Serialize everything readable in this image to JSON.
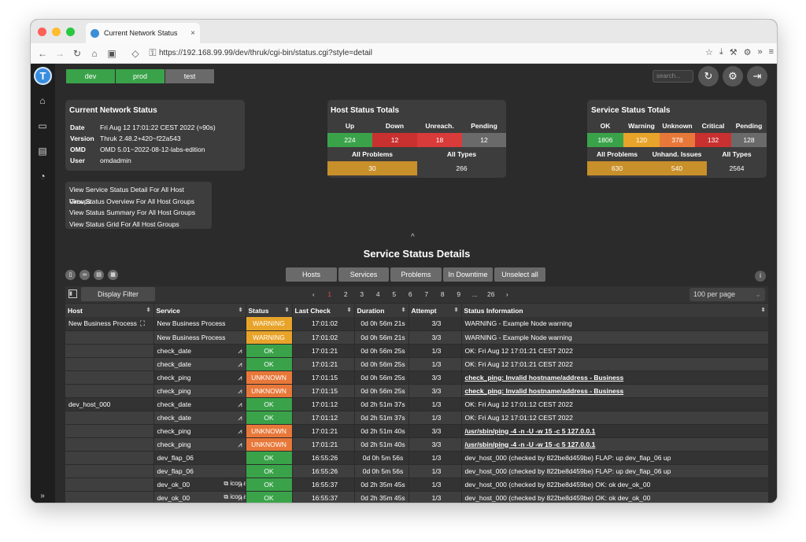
{
  "browser": {
    "tab_title": "Current Network Status",
    "tab_close": "×",
    "url": "https://192.168.99.99/dev/thruk/cgi-bin/status.cgi?style=detail"
  },
  "envs": [
    {
      "label": "dev",
      "color": "#3aa34a"
    },
    {
      "label": "prod",
      "color": "#3aa34a"
    },
    {
      "label": "test",
      "color": "#6a6a6a"
    }
  ],
  "search_placeholder": "search...",
  "status_panel": {
    "title": "Current Network Status",
    "rows": [
      {
        "key": "Date",
        "value": "Fri Aug 12 17:01:22 CEST 2022 (≈90s)"
      },
      {
        "key": "Version",
        "value": "Thruk 2.48.2+420~f22a543"
      },
      {
        "key": "OMD",
        "value": "OMD 5.01~2022-08-12-labs-edition"
      },
      {
        "key": "User",
        "value": "omdadmin"
      }
    ]
  },
  "links": [
    "View Service Status Detail For All Host Groups",
    "View Status Overview For All Host Groups",
    "View Status Summary For All Host Groups",
    "View Status Grid For All Host Groups"
  ],
  "host_totals": {
    "title": "Host Status Totals",
    "headers": [
      "Up",
      "Down",
      "Unreach.",
      "Pending"
    ],
    "values": [
      "224",
      "12",
      "18",
      "12"
    ],
    "colors": [
      "#3aa34a",
      "#c93030",
      "#d93a3a",
      "#6a6a6a"
    ],
    "sub_headers": [
      "All Problems",
      "All Types"
    ],
    "sub_values": [
      "30",
      "266"
    ]
  },
  "service_totals": {
    "title": "Service Status Totals",
    "headers": [
      "OK",
      "Warning",
      "Unknown",
      "Critical",
      "Pending"
    ],
    "values": [
      "1806",
      "120",
      "378",
      "132",
      "128"
    ],
    "colors": [
      "#3aa34a",
      "#e8a42a",
      "#e8783a",
      "#c93030",
      "#6a6a6a"
    ],
    "sub_headers": [
      "All Problems",
      "Unhand. Issues",
      "All Types"
    ],
    "sub_values": [
      "630",
      "540",
      "2564"
    ]
  },
  "section_title": "Service Status Details",
  "filter_buttons": [
    "Hosts",
    "Services",
    "Problems",
    "In Downtime",
    "Unselect all"
  ],
  "display_filter": "Display Filter",
  "pager": [
    "‹",
    "1",
    "2",
    "3",
    "4",
    "5",
    "6",
    "7",
    "8",
    "9",
    "...",
    "26",
    "›"
  ],
  "per_page": "100 per page",
  "columns": [
    "Host",
    "Service",
    "Status",
    "Last Check",
    "Duration",
    "Attempt",
    "Status Information"
  ],
  "rows": [
    {
      "host": "New Business Process",
      "service": "New Business Process",
      "status": "WARNING",
      "last": "17:01:02",
      "duration": "0d 0h 56m 21s",
      "attempt": "3/3",
      "info": "WARNING - Example Node warning",
      "graph": false,
      "link": false
    },
    {
      "host": "",
      "service": "New Business Process",
      "status": "WARNING",
      "last": "17:01:02",
      "duration": "0d 0h 56m 21s",
      "attempt": "3/3",
      "info": "WARNING - Example Node warning",
      "graph": false,
      "link": false
    },
    {
      "host": "",
      "service": "check_date",
      "status": "OK",
      "last": "17:01:21",
      "duration": "0d 0h 56m 25s",
      "attempt": "1/3",
      "info": "OK: Fri Aug 12 17:01:21 CEST 2022",
      "graph": true,
      "link": false
    },
    {
      "host": "",
      "service": "check_date",
      "status": "OK",
      "last": "17:01:21",
      "duration": "0d 0h 56m 25s",
      "attempt": "1/3",
      "info": "OK: Fri Aug 12 17:01:21 CEST 2022",
      "graph": true,
      "link": false
    },
    {
      "host": "",
      "service": "check_ping",
      "status": "UNKNOWN",
      "last": "17:01:15",
      "duration": "0d 0h 56m 25s",
      "attempt": "3/3",
      "info": "check_ping: Invalid hostname/address - Business",
      "graph": true,
      "link": true
    },
    {
      "host": "",
      "service": "check_ping",
      "status": "UNKNOWN",
      "last": "17:01:15",
      "duration": "0d 0h 56m 25s",
      "attempt": "3/3",
      "info": "check_ping: Invalid hostname/address - Business",
      "graph": true,
      "link": true
    },
    {
      "host": "dev_host_000",
      "service": "check_date",
      "status": "OK",
      "last": "17:01:12",
      "duration": "0d 2h 51m 37s",
      "attempt": "1/3",
      "info": "OK: Fri Aug 12 17:01:12 CEST 2022",
      "graph": true,
      "link": false
    },
    {
      "host": "",
      "service": "check_date",
      "status": "OK",
      "last": "17:01:12",
      "duration": "0d 2h 51m 37s",
      "attempt": "1/3",
      "info": "OK: Fri Aug 12 17:01:12 CEST 2022",
      "graph": true,
      "link": false
    },
    {
      "host": "",
      "service": "check_ping",
      "status": "UNKNOWN",
      "last": "17:01:21",
      "duration": "0d 2h 51m 40s",
      "attempt": "3/3",
      "info": "/usr/sbin/ping -4 -n -U -w 15 -c 5 127.0.0.1",
      "graph": true,
      "link": true
    },
    {
      "host": "",
      "service": "check_ping",
      "status": "UNKNOWN",
      "last": "17:01:21",
      "duration": "0d 2h 51m 40s",
      "attempt": "3/3",
      "info": "/usr/sbin/ping -4 -n -U -w 15 -c 5 127.0.0.1",
      "graph": true,
      "link": true
    },
    {
      "host": "",
      "service": "dev_flap_06",
      "status": "OK",
      "last": "16:55:26",
      "duration": "0d 0h 5m 56s",
      "attempt": "1/3",
      "info": "dev_host_000 (checked by 822be8d459be) FLAP: up dev_flap_06 up",
      "graph": false,
      "link": false
    },
    {
      "host": "",
      "service": "dev_flap_06",
      "status": "OK",
      "last": "16:55:26",
      "duration": "0d 0h 5m 56s",
      "attempt": "1/3",
      "info": "dev_host_000 (checked by 822be8d459be) FLAP: up dev_flap_06 up",
      "graph": false,
      "link": false
    },
    {
      "host": "",
      "service": "dev_ok_00",
      "status": "OK",
      "last": "16:55:37",
      "duration": "0d 2h 35m 45s",
      "attempt": "1/3",
      "info": "dev_host_000 (checked by 822be8d459be) OK: ok dev_ok_00",
      "graph": true,
      "link": false,
      "alt": "icon alt string"
    },
    {
      "host": "",
      "service": "dev_ok_00",
      "status": "OK",
      "last": "16:55:37",
      "duration": "0d 2h 35m 45s",
      "attempt": "1/3",
      "info": "dev_host_000 (checked by 822be8d459be) OK: ok dev_ok_00",
      "graph": true,
      "link": false,
      "alt": "icon alt string"
    }
  ]
}
